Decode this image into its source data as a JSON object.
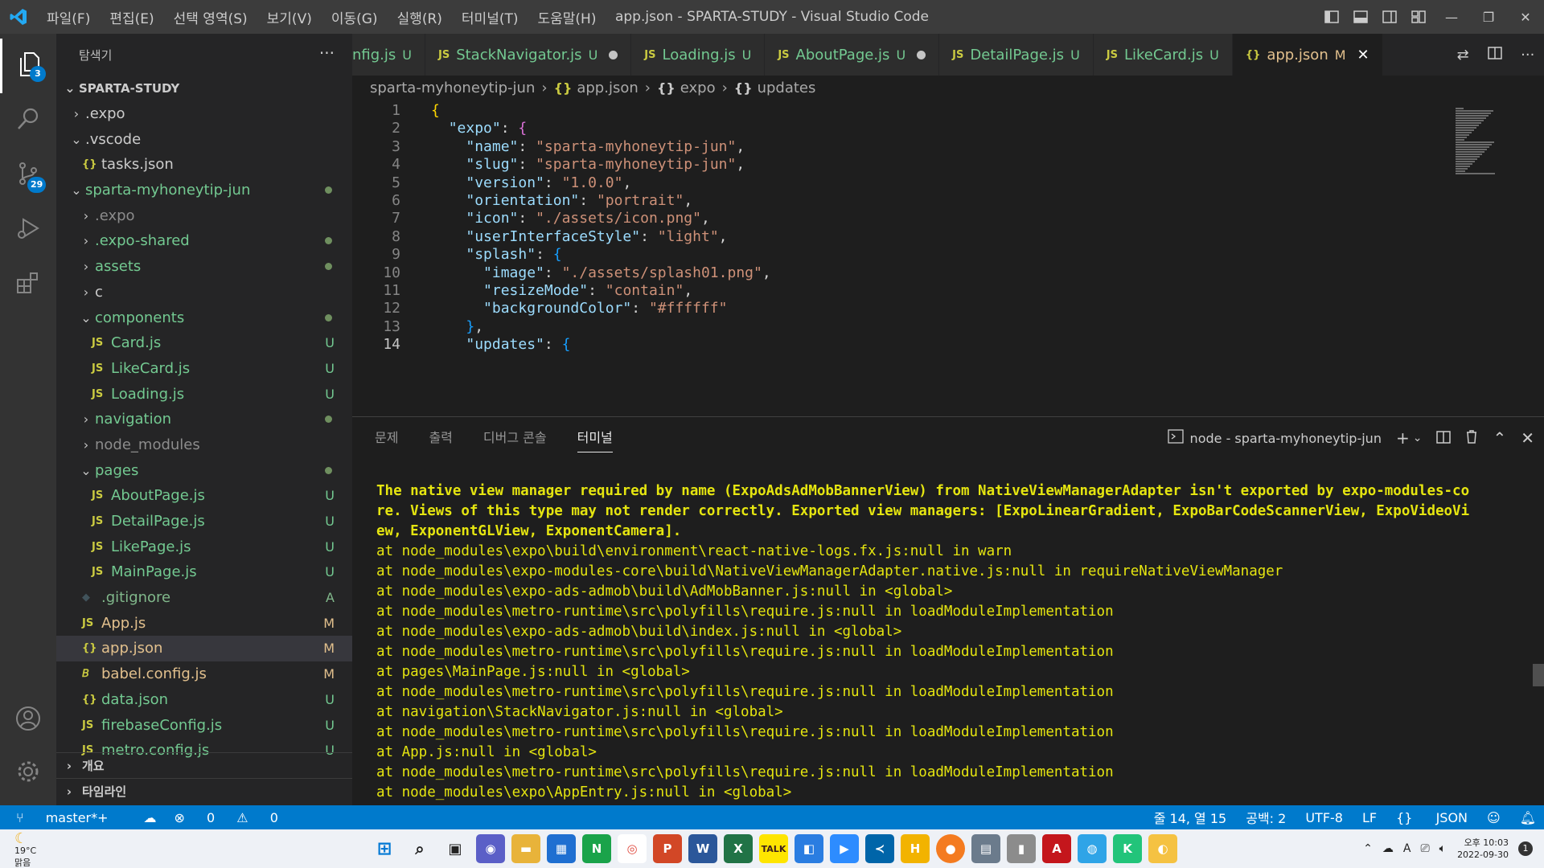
{
  "window": {
    "title": "app.json - SPARTA-STUDY - Visual Studio Code",
    "menu": [
      "파일(F)",
      "편집(E)",
      "선택 영역(S)",
      "보기(V)",
      "이동(G)",
      "실행(R)",
      "터미널(T)",
      "도움말(H)"
    ]
  },
  "activity": {
    "explorer_badge": "3",
    "scm_badge": "29"
  },
  "sidebar": {
    "title": "탐색기",
    "more": "···",
    "root": "SPARTA-STUDY",
    "rows": [
      {
        "label": ".expo",
        "chev": "›",
        "status": ""
      },
      {
        "label": ".vscode",
        "chev": "⌄",
        "status": ""
      },
      {
        "label": "tasks.json",
        "icon": "{}",
        "status": ""
      },
      {
        "label": "sparta-myhoneytip-jun",
        "chev": "⌄",
        "status": "dot"
      },
      {
        "label": ".expo",
        "chev": "›",
        "status": ""
      },
      {
        "label": ".expo-shared",
        "chev": "›",
        "status": "dot"
      },
      {
        "label": "assets",
        "chev": "›",
        "status": "dot"
      },
      {
        "label": "c",
        "chev": "›",
        "status": ""
      },
      {
        "label": "components",
        "chev": "⌄",
        "status": "dot"
      },
      {
        "label": "Card.js",
        "icon": "JS",
        "status": "U"
      },
      {
        "label": "LikeCard.js",
        "icon": "JS",
        "status": "U"
      },
      {
        "label": "Loading.js",
        "icon": "JS",
        "status": "U"
      },
      {
        "label": "navigation",
        "chev": "›",
        "status": "dot"
      },
      {
        "label": "node_modules",
        "chev": "›",
        "status": ""
      },
      {
        "label": "pages",
        "chev": "⌄",
        "status": "dot"
      },
      {
        "label": "AboutPage.js",
        "icon": "JS",
        "status": "U"
      },
      {
        "label": "DetailPage.js",
        "icon": "JS",
        "status": "U"
      },
      {
        "label": "LikePage.js",
        "icon": "JS",
        "status": "U"
      },
      {
        "label": "MainPage.js",
        "icon": "JS",
        "status": "U"
      },
      {
        "label": ".gitignore",
        "icon": "◆",
        "status": "A"
      },
      {
        "label": "App.js",
        "icon": "JS",
        "status": "M"
      },
      {
        "label": "app.json",
        "icon": "{}",
        "status": "M"
      },
      {
        "label": "babel.config.js",
        "icon": "𝘉",
        "status": "M"
      },
      {
        "label": "data.json",
        "icon": "{}",
        "status": "U"
      },
      {
        "label": "firebaseConfig.js",
        "icon": "JS",
        "status": "U"
      },
      {
        "label": "metro.config.js",
        "icon": "JS",
        "status": "U"
      }
    ],
    "outline_label": "개요",
    "timeline_label": "타임라인"
  },
  "tabs": [
    {
      "icon": "",
      "label": "nfig.js",
      "status": "U",
      "modified": false
    },
    {
      "icon": "JS",
      "label": "StackNavigator.js",
      "status": "U",
      "modified": true
    },
    {
      "icon": "JS",
      "label": "Loading.js",
      "status": "U",
      "modified": false
    },
    {
      "icon": "JS",
      "label": "AboutPage.js",
      "status": "U",
      "modified": true
    },
    {
      "icon": "JS",
      "label": "DetailPage.js",
      "status": "U",
      "modified": false
    },
    {
      "icon": "JS",
      "label": "LikeCard.js",
      "status": "U",
      "modified": false
    },
    {
      "icon": "{}",
      "label": "app.json",
      "status": "M",
      "modified": false
    }
  ],
  "breadcrumb": [
    "sparta-myhoneytip-jun",
    "app.json",
    "expo",
    "updates"
  ],
  "editor": {
    "current_line": 14,
    "lines": [
      {
        "n": "1",
        "text": "{"
      },
      {
        "n": "2",
        "text": "  \"expo\": {"
      },
      {
        "n": "3",
        "text": "    \"name\": \"sparta-myhoneytip-jun\","
      },
      {
        "n": "4",
        "text": "    \"slug\": \"sparta-myhoneytip-jun\","
      },
      {
        "n": "5",
        "text": "    \"version\": \"1.0.0\","
      },
      {
        "n": "6",
        "text": "    \"orientation\": \"portrait\","
      },
      {
        "n": "7",
        "text": "    \"icon\": \"./assets/icon.png\","
      },
      {
        "n": "8",
        "text": "    \"userInterfaceStyle\": \"light\","
      },
      {
        "n": "9",
        "text": "    \"splash\": {"
      },
      {
        "n": "10",
        "text": "      \"image\": \"./assets/splash01.png\","
      },
      {
        "n": "11",
        "text": "      \"resizeMode\": \"contain\","
      },
      {
        "n": "12",
        "text": "      \"backgroundColor\": \"#ffffff\""
      },
      {
        "n": "13",
        "text": "    },"
      },
      {
        "n": "14",
        "text": "    \"updates\": {"
      }
    ]
  },
  "panel": {
    "tabs": [
      "문제",
      "출력",
      "디버그 콘솔",
      "터미널"
    ],
    "active_tab": "터미널",
    "terminal_name": "node - sparta-myhoneytip-jun",
    "terminal_lines": [
      "The native view manager required by name (ExpoAdsAdMobBannerView) from NativeViewManagerAdapter isn't exported by expo-modules-co",
      "re. Views of this type may not render correctly. Exported view managers: [ExpoLinearGradient, ExpoBarCodeScannerView, ExpoVideoVi",
      "ew, ExponentGLView, ExponentCamera].",
      "at node_modules\\expo\\build\\environment\\react-native-logs.fx.js:null in warn",
      "at node_modules\\expo-modules-core\\build\\NativeViewManagerAdapter.native.js:null in requireNativeViewManager",
      "at node_modules\\expo-ads-admob\\build\\AdMobBanner.js:null in <global>",
      "at node_modules\\metro-runtime\\src\\polyfills\\require.js:null in loadModuleImplementation",
      "at node_modules\\expo-ads-admob\\build\\index.js:null in <global>",
      "at node_modules\\metro-runtime\\src\\polyfills\\require.js:null in loadModuleImplementation",
      "at pages\\MainPage.js:null in <global>",
      "at node_modules\\metro-runtime\\src\\polyfills\\require.js:null in loadModuleImplementation",
      "at navigation\\StackNavigator.js:null in <global>",
      "at node_modules\\metro-runtime\\src\\polyfills\\require.js:null in loadModuleImplementation",
      "at App.js:null in <global>",
      "at node_modules\\metro-runtime\\src\\polyfills\\require.js:null in loadModuleImplementation",
      "at node_modules\\expo\\AppEntry.js:null in <global>"
    ]
  },
  "statusbar": {
    "branch": "master*+",
    "errors": "0",
    "warnings": "0",
    "position": "줄 14, 열 15",
    "spaces": "공백: 2",
    "encoding": "UTF-8",
    "eol": "LF",
    "language": "JSON"
  },
  "taskbar": {
    "weather_temp": "19°C",
    "weather_desc": "맑음",
    "time": "오후 10:03",
    "date": "2022-09-30",
    "ime": "A",
    "notif_count": "1"
  },
  "colors": {
    "accent": "#007acc",
    "titlebar": "#3c3c3c",
    "editor_bg": "#1e1e1e",
    "terminal_text": "#e5e510"
  }
}
